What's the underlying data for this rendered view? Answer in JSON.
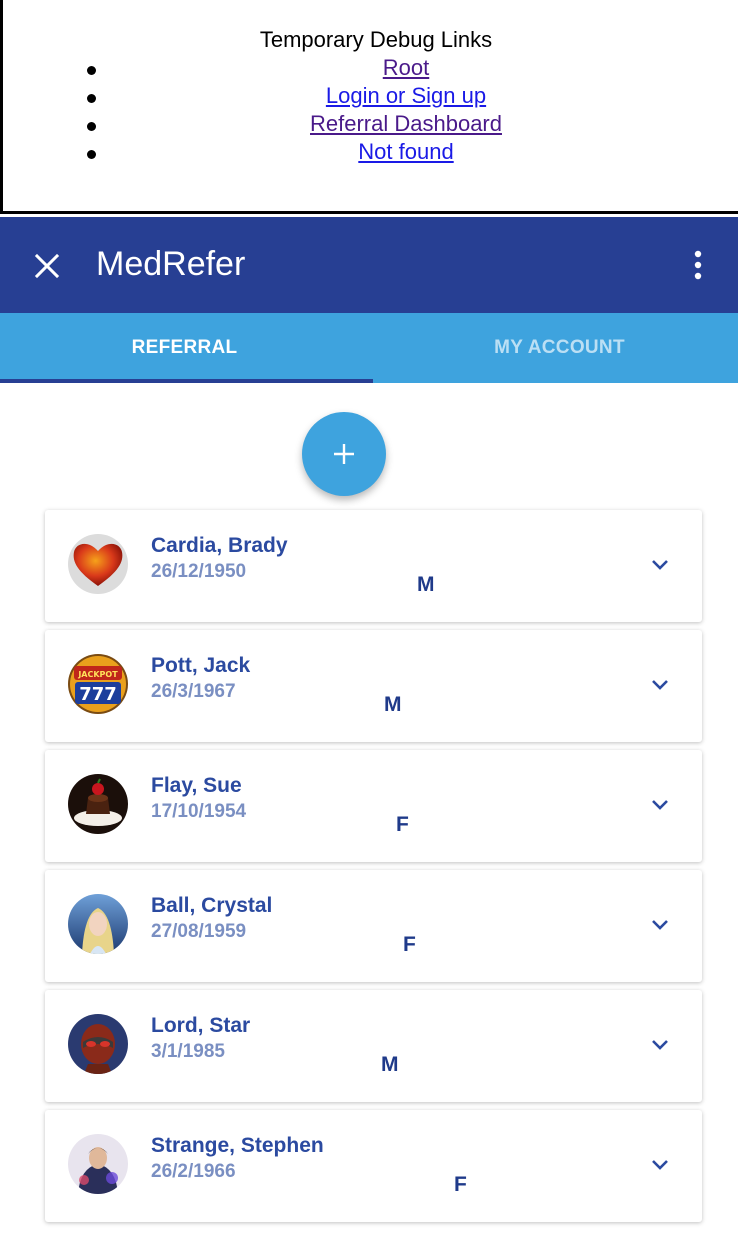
{
  "debug": {
    "title": "Temporary Debug Links",
    "links": [
      "Root",
      "Login or Sign up",
      "Referral Dashboard",
      "Not found"
    ]
  },
  "appbar": {
    "title": "MedRefer",
    "close_icon": "close-icon",
    "menu_icon": "more-vert-icon"
  },
  "tabs": [
    {
      "label": "REFERRAL",
      "active": true
    },
    {
      "label": "MY ACCOUNT",
      "active": false
    }
  ],
  "fab": {
    "icon": "plus-icon"
  },
  "colors": {
    "appbar": "#273f93",
    "tabs": "#3ea3de",
    "accent": "#3ea3de",
    "name_text": "#2b4aa0",
    "dob_text": "#7a8fc2"
  },
  "patients": [
    {
      "name": "Cardia, Brady",
      "dob": "26/12/1950",
      "gender": "M",
      "avatar": "heart"
    },
    {
      "name": "Pott, Jack",
      "dob": "26/3/1967",
      "gender": "M",
      "avatar": "jackpot-777"
    },
    {
      "name": "Flay, Sue",
      "dob": "17/10/1954",
      "gender": "F",
      "avatar": "chocolate-dessert"
    },
    {
      "name": "Ball, Crystal",
      "dob": "27/08/1959",
      "gender": "F",
      "avatar": "fantasy-woman"
    },
    {
      "name": "Lord, Star",
      "dob": "3/1/1985",
      "gender": "M",
      "avatar": "star-lord-helmet"
    },
    {
      "name": "Strange, Stephen",
      "dob": "26/2/1966",
      "gender": "F",
      "avatar": "doctor-strange"
    }
  ]
}
